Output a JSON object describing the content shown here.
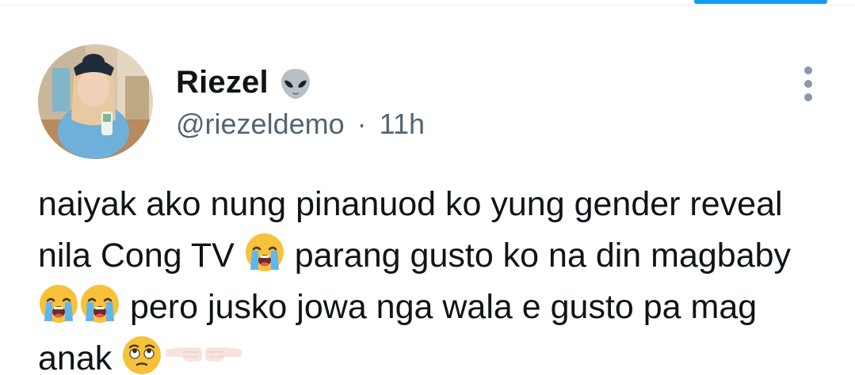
{
  "tweet": {
    "author": {
      "display_name": "Riezel",
      "name_emoji": "alien-icon",
      "handle": "@riezeldemo",
      "separator": "·",
      "time": "11h"
    },
    "text": {
      "line1": "naiyak ako nung pinanuod ko yung gender reveal",
      "line2_a": "nila Cong TV",
      "line2_b": "parang gusto ko na din magbaby",
      "line3": "pero jusko jowa nga wala e gusto pa mag",
      "line4": "anak"
    },
    "emojis": [
      "loudly-crying-face-icon",
      "face-with-rolling-eyes-icon",
      "backhand-index-pointing-left-icon",
      "backhand-index-pointing-right-icon"
    ]
  },
  "colors": {
    "text_primary": "#0f1419",
    "text_secondary": "#536471",
    "accent": "#1d9bf0"
  }
}
